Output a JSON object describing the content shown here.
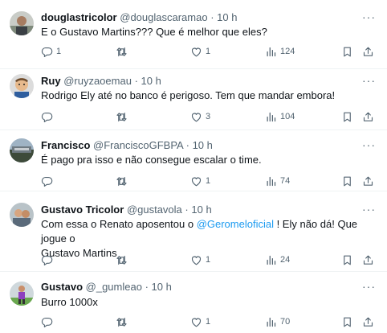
{
  "tweets": [
    {
      "name": "douglastricolor",
      "handle": "@douglascaramao",
      "time": "10 h",
      "text": "E o Gustavo Martins??? Que é melhor que eles?",
      "replies": "1",
      "retweets": "",
      "likes": "1",
      "views": "124"
    },
    {
      "name": "Ruy",
      "handle": "@ruyzaoemau",
      "time": "10 h",
      "text": "Rodrigo Ely até no banco é perigoso. Tem que mandar embora!",
      "replies": "",
      "retweets": "",
      "likes": "3",
      "views": "104"
    },
    {
      "name": "Francisco",
      "handle": "@FranciscoGFBPA",
      "time": "10 h",
      "text": "É pago pra isso e não consegue escalar o time.",
      "replies": "",
      "retweets": "",
      "likes": "1",
      "views": "74"
    },
    {
      "name": "Gustavo Tricolor",
      "handle": "@gustavola",
      "time": "10 h",
      "text_before": "Com essa o Renato aposentou o ",
      "mention": "@Geromeloficial",
      "text_after": " ! Ely não dá! Que jogue o",
      "text_line2": "Gustavo Martins",
      "replies": "",
      "retweets": "",
      "likes": "1",
      "views": "24"
    },
    {
      "name": "Gustavo",
      "handle": "@_gumleao",
      "time": "10 h",
      "text": "Burro 1000x",
      "replies": "",
      "retweets": "",
      "likes": "1",
      "views": "70"
    }
  ],
  "separator": "·",
  "icons": {
    "reply": "reply-icon",
    "retweet": "retweet-icon",
    "like": "heart-icon",
    "views": "views-bar-icon",
    "bookmark": "bookmark-icon",
    "share": "share-icon",
    "more": "more-dots-icon"
  },
  "colors": {
    "text": "#0f1419",
    "secondary": "#536471",
    "link": "#1d9bf0",
    "divider": "#eff3f4"
  }
}
